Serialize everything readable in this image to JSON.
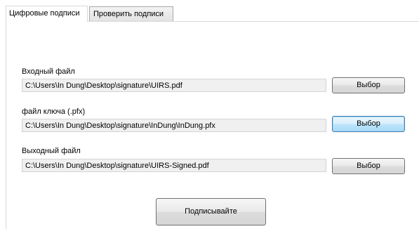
{
  "tabs": [
    {
      "label": "Цифровые подписи",
      "active": true
    },
    {
      "label": "Проверить подписи",
      "active": false
    }
  ],
  "input_file": {
    "label": "Входный файл",
    "value": "C:\\Users\\In Dung\\Desktop\\signature\\UIRS.pdf",
    "browse_label": "Выбор"
  },
  "key_file": {
    "label": "файл ключа (.pfx)",
    "value": "C:\\Users\\In Dung\\Desktop\\signature\\InDung\\InDung.pfx",
    "browse_label": "Выбор"
  },
  "output_file": {
    "label": "Выходный файл",
    "value": "C:\\Users\\In Dung\\Desktop\\signature\\UIRS-Signed.pdf",
    "browse_label": "Выбор"
  },
  "sign_button": {
    "label": "Подписывайте"
  },
  "colors": {
    "background": "#ffffff",
    "readonly_field": "#f0f0f0",
    "focus_border": "#3c7fb1"
  }
}
